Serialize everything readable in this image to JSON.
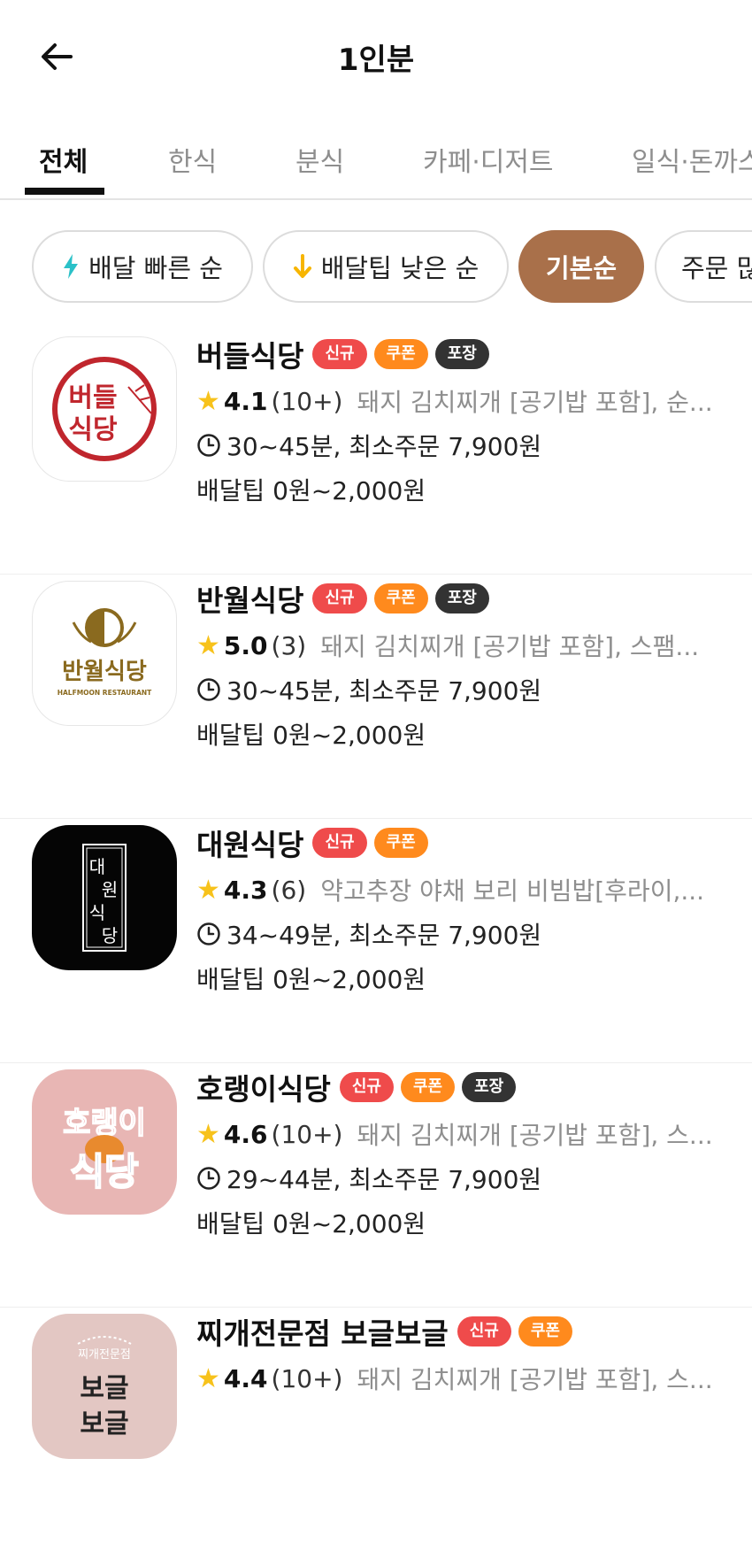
{
  "header": {
    "title": "1인분"
  },
  "tabs": [
    {
      "label": "전체"
    },
    {
      "label": "한식"
    },
    {
      "label": "분식"
    },
    {
      "label": "카페·디저트"
    },
    {
      "label": "일식·돈까스"
    }
  ],
  "sort_chips": [
    {
      "label": "배달 빠른 순",
      "icon": "lightning-icon"
    },
    {
      "label": "배달팁 낮은 순",
      "icon": "arrow-down-icon"
    },
    {
      "label": "기본순",
      "active": true
    },
    {
      "label": "주문 많은 순"
    }
  ],
  "restaurants": [
    {
      "name": "버들식당",
      "badges": [
        "신규",
        "쿠폰",
        "포장"
      ],
      "rating": "4.1",
      "reviews": "(10+)",
      "menu": "돼지 김치찌개 [공기밥 포함], 순...",
      "time_min": "30~45분, 최소주문 7,900원",
      "delivery_tip": "배달팁 0원~2,000원",
      "logo_text": [
        "버들",
        "식당"
      ]
    },
    {
      "name": "반월식당",
      "badges": [
        "신규",
        "쿠폰",
        "포장"
      ],
      "rating": "5.0",
      "reviews": "(3)",
      "menu": "돼지 김치찌개 [공기밥 포함], 스팸...",
      "time_min": "30~45분, 최소주문 7,900원",
      "delivery_tip": "배달팁 0원~2,000원",
      "logo_text": [
        "반월식당",
        "HALFMOON RESTAURANT"
      ]
    },
    {
      "name": "대원식당",
      "badges": [
        "신규",
        "쿠폰"
      ],
      "rating": "4.3",
      "reviews": "(6)",
      "menu": "약고추장 야채 보리 비빔밥[후라이,...",
      "time_min": "34~49분, 최소주문 7,900원",
      "delivery_tip": "배달팁 0원~2,000원",
      "logo_text": [
        "대",
        "원",
        "식",
        "당"
      ]
    },
    {
      "name": "호랭이식당",
      "badges": [
        "신규",
        "쿠폰",
        "포장"
      ],
      "rating": "4.6",
      "reviews": "(10+)",
      "menu": "돼지 김치찌개 [공기밥 포함], 스...",
      "time_min": "29~44분, 최소주문 7,900원",
      "delivery_tip": "배달팁 0원~2,000원",
      "logo_text": [
        "호랭이",
        "식당"
      ]
    },
    {
      "name": "찌개전문점 보글보글",
      "badges": [
        "신규",
        "쿠폰"
      ],
      "rating": "4.4",
      "reviews": "(10+)",
      "menu": "돼지 김치찌개 [공기밥 포함], 스...",
      "time_min": "",
      "delivery_tip": "",
      "logo_text": [
        "찌개전문점",
        "보글",
        "보글"
      ]
    }
  ],
  "colors": {
    "accent_brown": "#a9704a",
    "badge_new": "#ef4b4b",
    "badge_coupon": "#ff8a1d",
    "badge_pack": "#333333",
    "star": "#f7c21b"
  }
}
